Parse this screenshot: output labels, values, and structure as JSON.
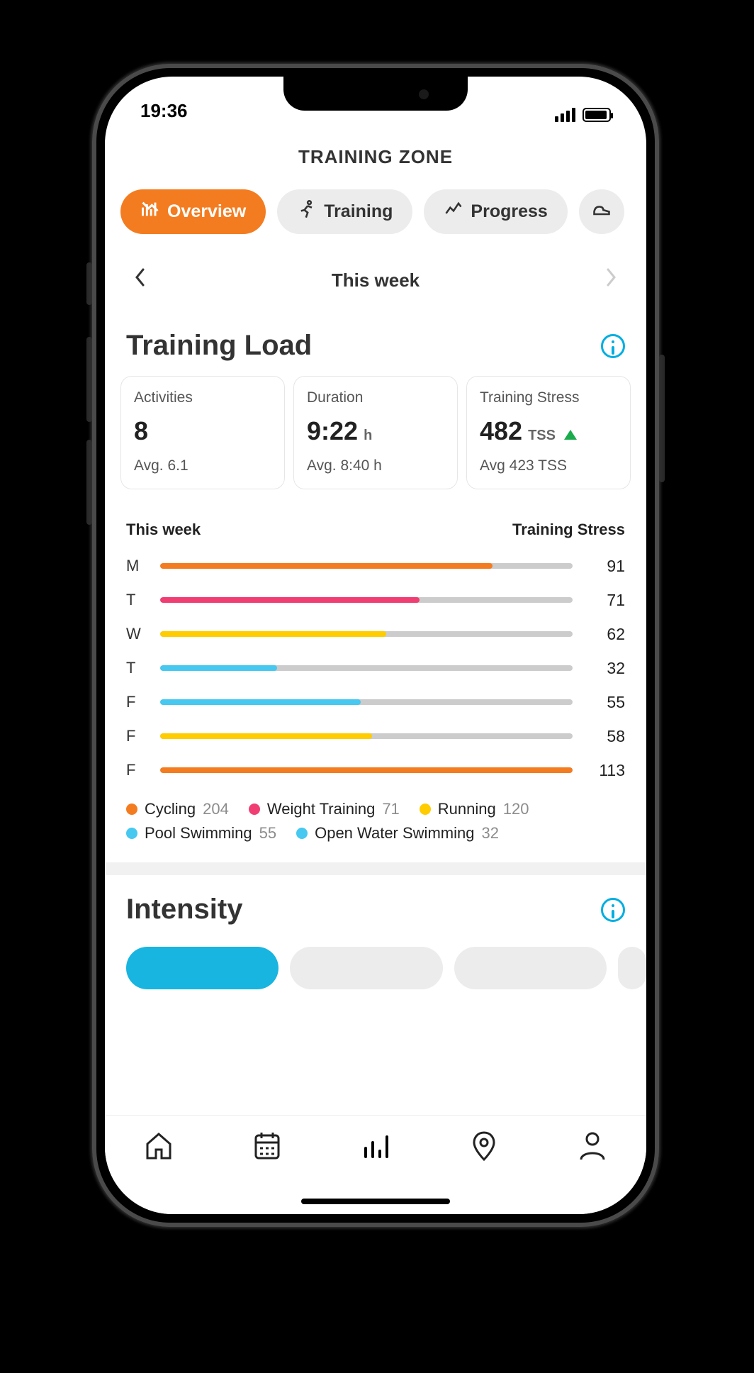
{
  "status": {
    "time": "19:36"
  },
  "header": {
    "title": "TRAINING ZONE"
  },
  "tabs": [
    {
      "id": "overview",
      "label": "Overview",
      "active": true
    },
    {
      "id": "training",
      "label": "Training",
      "active": false
    },
    {
      "id": "progress",
      "label": "Progress",
      "active": false
    },
    {
      "id": "more",
      "label": "",
      "active": false
    }
  ],
  "weeknav": {
    "label": "This week"
  },
  "training_load": {
    "title": "Training Load",
    "cards": {
      "activities": {
        "label": "Activities",
        "value": "8",
        "avg": "Avg. 6.1"
      },
      "duration": {
        "label": "Duration",
        "value": "9:22",
        "unit": "h",
        "avg": "Avg. 8:40 h"
      },
      "stress": {
        "label": "Training Stress",
        "value": "482",
        "unit": "TSS",
        "trend": "up",
        "avg": "Avg 423 TSS"
      }
    }
  },
  "chart_head": {
    "left": "This week",
    "right": "Training Stress"
  },
  "chart_data": {
    "type": "bar",
    "categories": [
      "M",
      "T",
      "W",
      "T",
      "F",
      "F",
      "F"
    ],
    "values": [
      91,
      71,
      62,
      32,
      55,
      58,
      113
    ],
    "series_color_by_row": [
      "#f47c20",
      "#f03e72",
      "#ffcc00",
      "#46c8f0",
      "#46c8f0",
      "#ffcc00",
      "#f47c20"
    ],
    "title": "Training Stress (This week)",
    "xlabel": "",
    "ylabel": "Training Stress",
    "ylim": [
      0,
      113
    ]
  },
  "legend": [
    {
      "name": "Cycling",
      "value": 204,
      "color": "#f47c20"
    },
    {
      "name": "Weight Training",
      "value": 71,
      "color": "#f03e72"
    },
    {
      "name": "Running",
      "value": 120,
      "color": "#ffcc00"
    },
    {
      "name": "Pool Swimming",
      "value": 55,
      "color": "#46c8f0"
    },
    {
      "name": "Open Water Swimming",
      "value": 32,
      "color": "#46c8f0"
    }
  ],
  "intensity": {
    "title": "Intensity"
  },
  "colors": {
    "accent": "#f47c20",
    "info": "#00aee0",
    "blue": "#17b5e0"
  }
}
